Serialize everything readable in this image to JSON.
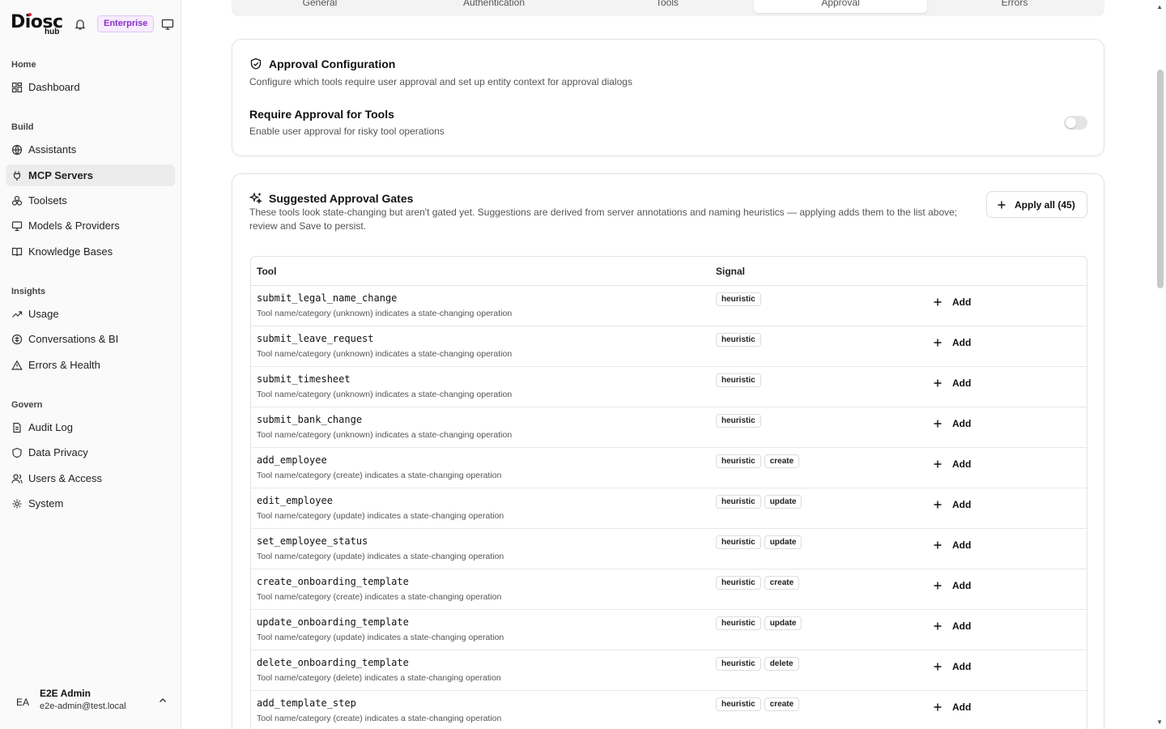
{
  "brand": {
    "logo": "Diosc",
    "sub": "hub",
    "badge": "Enterprise"
  },
  "sidebar": {
    "groups": [
      {
        "label": "Home"
      },
      {
        "label": "Build"
      },
      {
        "label": "Insights"
      },
      {
        "label": "Govern"
      }
    ],
    "items": [
      {
        "label": "Dashboard",
        "icon": "dashboard-icon"
      },
      {
        "label": "Assistants",
        "icon": "globe-icon"
      },
      {
        "label": "MCP Servers",
        "icon": "plug-icon",
        "active": true
      },
      {
        "label": "Toolsets",
        "icon": "toolset-icon"
      },
      {
        "label": "Models & Providers",
        "icon": "monitor-icon"
      },
      {
        "label": "Knowledge Bases",
        "icon": "book-icon"
      },
      {
        "label": "Usage",
        "icon": "trend-icon"
      },
      {
        "label": "Conversations & BI",
        "icon": "conversations-icon"
      },
      {
        "label": "Errors & Health",
        "icon": "warning-icon"
      },
      {
        "label": "Audit Log",
        "icon": "file-icon"
      },
      {
        "label": "Data Privacy",
        "icon": "shield-icon"
      },
      {
        "label": "Users & Access",
        "icon": "users-icon"
      },
      {
        "label": "System",
        "icon": "gear-icon"
      }
    ],
    "user": {
      "initials": "EA",
      "name": "E2E Admin",
      "email": "e2e-admin@test.local"
    }
  },
  "tabs": [
    "General",
    "Authentication",
    "Tools",
    "Approval",
    "Errors"
  ],
  "active_tab": "Approval",
  "approval": {
    "title": "Approval Configuration",
    "description": "Configure which tools require user approval and set up entity context for approval dialogs",
    "require_title": "Require Approval for Tools",
    "require_desc": "Enable user approval for risky tool operations",
    "require_enabled": false
  },
  "suggested": {
    "title": "Suggested Approval Gates",
    "description": "These tools look state-changing but aren't gated yet. Suggestions are derived from server annotations and naming heuristics — applying adds them to the list above; review and Save to persist.",
    "apply_all": "Apply all (45)",
    "col_tool": "Tool",
    "col_signal": "Signal",
    "add_label": "Add",
    "rows": [
      {
        "name": "submit_legal_name_change",
        "desc": "Tool name/category (unknown) indicates a state-changing operation",
        "chips": [
          "heuristic"
        ]
      },
      {
        "name": "submit_leave_request",
        "desc": "Tool name/category (unknown) indicates a state-changing operation",
        "chips": [
          "heuristic"
        ]
      },
      {
        "name": "submit_timesheet",
        "desc": "Tool name/category (unknown) indicates a state-changing operation",
        "chips": [
          "heuristic"
        ]
      },
      {
        "name": "submit_bank_change",
        "desc": "Tool name/category (unknown) indicates a state-changing operation",
        "chips": [
          "heuristic"
        ]
      },
      {
        "name": "add_employee",
        "desc": "Tool name/category (create) indicates a state-changing operation",
        "chips": [
          "heuristic",
          "create"
        ]
      },
      {
        "name": "edit_employee",
        "desc": "Tool name/category (update) indicates a state-changing operation",
        "chips": [
          "heuristic",
          "update"
        ]
      },
      {
        "name": "set_employee_status",
        "desc": "Tool name/category (update) indicates a state-changing operation",
        "chips": [
          "heuristic",
          "update"
        ]
      },
      {
        "name": "create_onboarding_template",
        "desc": "Tool name/category (create) indicates a state-changing operation",
        "chips": [
          "heuristic",
          "create"
        ]
      },
      {
        "name": "update_onboarding_template",
        "desc": "Tool name/category (update) indicates a state-changing operation",
        "chips": [
          "heuristic",
          "update"
        ]
      },
      {
        "name": "delete_onboarding_template",
        "desc": "Tool name/category (delete) indicates a state-changing operation",
        "chips": [
          "heuristic",
          "delete"
        ]
      },
      {
        "name": "add_template_step",
        "desc": "Tool name/category (create) indicates a state-changing operation",
        "chips": [
          "heuristic",
          "create"
        ]
      }
    ]
  }
}
